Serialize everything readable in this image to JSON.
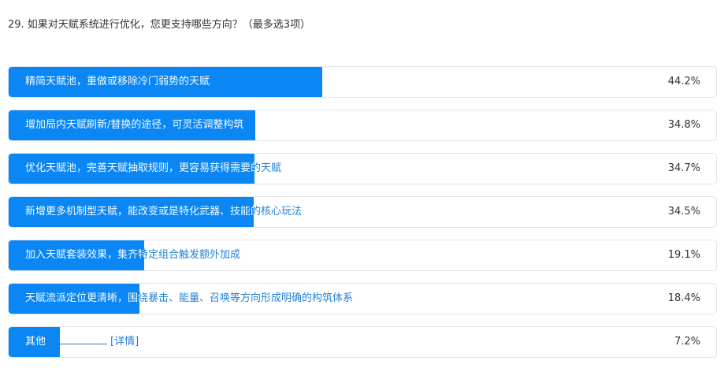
{
  "question": "29. 如果对天赋系统进行优化，您更支持哪些方向？（最多选3项）",
  "colors": {
    "bar": "#0a87f5",
    "label_outside": "#1e7fd6",
    "border": "#dde3ec"
  },
  "chart_data": {
    "type": "bar",
    "orientation": "horizontal",
    "categories": [
      "精简天赋池，重做或移除冷门弱势的天赋",
      "增加局内天赋刷新/替换的途径，可灵活调整构筑",
      "优化天赋池，完善天赋抽取规则，更容易获得需要的天赋",
      "新增更多机制型天赋，能改变或是特化武器、技能的核心玩法",
      "加入天赋套装效果，集齐特定组合触发额外加成",
      "天赋流派定位更清晰，围绕暴击、能量、召唤等方向形成明确的构筑体系",
      "其他"
    ],
    "values": [
      44.2,
      34.8,
      34.7,
      34.5,
      19.1,
      18.4,
      7.2
    ],
    "value_labels": [
      "44.2%",
      "34.8%",
      "34.7%",
      "34.5%",
      "19.1%",
      "18.4%",
      "7.2%"
    ],
    "unit": "%",
    "xlim": [
      0,
      100
    ]
  },
  "other": {
    "label": "其他",
    "link": "[详情]"
  }
}
